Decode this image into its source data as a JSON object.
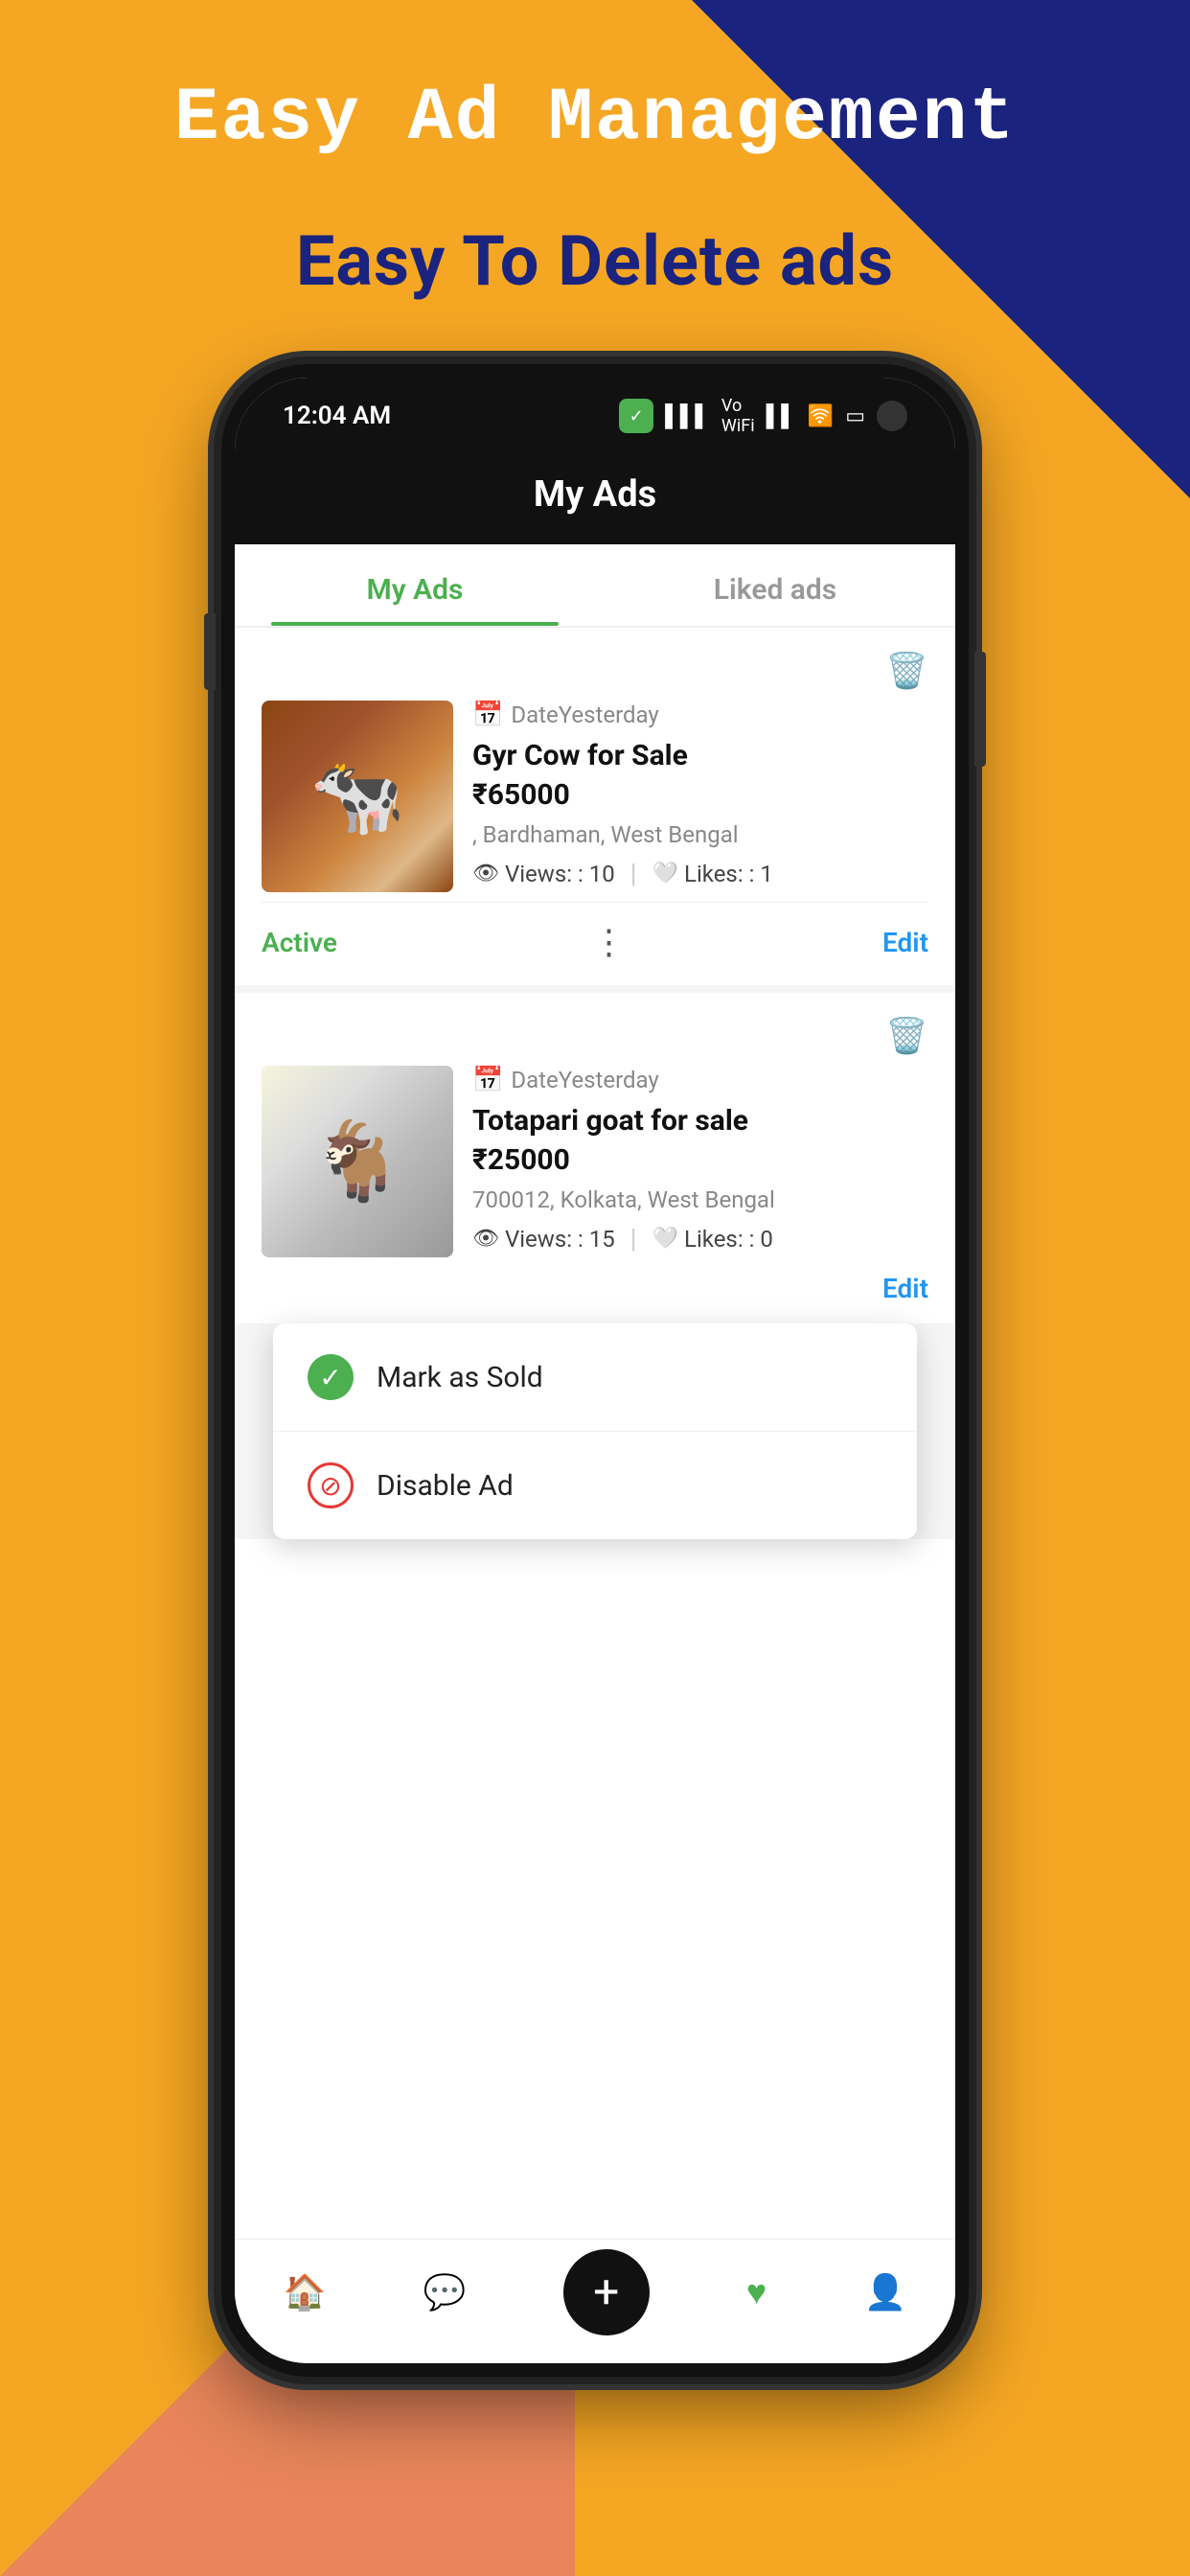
{
  "background": {
    "color": "#F5A623"
  },
  "header": {
    "title1": "Easy Ad Management",
    "title2": "Easy To Delete ads"
  },
  "statusBar": {
    "time": "12:04 AM",
    "appIcon": "✓",
    "signal": "▌▌▌",
    "wifi": "WiFi",
    "signal2": "▌▌▌",
    "wifiSymbol": "🛜",
    "battery": "▭"
  },
  "appHeader": {
    "title": "My Ads"
  },
  "tabs": [
    {
      "label": "My Ads",
      "active": true
    },
    {
      "label": "Liked ads",
      "active": false
    }
  ],
  "ads": [
    {
      "id": 1,
      "date": "DateYesterday",
      "title": "Gyr Cow for Sale",
      "price": "₹65000",
      "location": ", Bardhaman, West Bengal",
      "views": "10",
      "likes": "1",
      "status": "Active",
      "imageType": "cow"
    },
    {
      "id": 2,
      "date": "DateYesterday",
      "title": "Totapari goat for sale",
      "price": "₹25000",
      "location": "700012, Kolkata, West Bengal",
      "views": "15",
      "likes": "0",
      "status": null,
      "imageType": "goat"
    }
  ],
  "contextMenu": {
    "items": [
      {
        "label": "Mark as Sold",
        "iconType": "check"
      },
      {
        "label": "Disable Ad",
        "iconType": "disable"
      }
    ]
  },
  "labels": {
    "viewsPrefix": "Views: : ",
    "likesPrefix": "Likes: : ",
    "active": "Active",
    "edit": "Edit",
    "moreDots": "⋮"
  },
  "bottomNav": {
    "items": [
      {
        "icon": "🏠",
        "name": "home"
      },
      {
        "icon": "💬",
        "name": "messages"
      },
      {
        "icon": "+",
        "name": "add",
        "special": true
      },
      {
        "icon": "🤍",
        "name": "liked"
      },
      {
        "icon": "👤",
        "name": "profile"
      }
    ]
  }
}
